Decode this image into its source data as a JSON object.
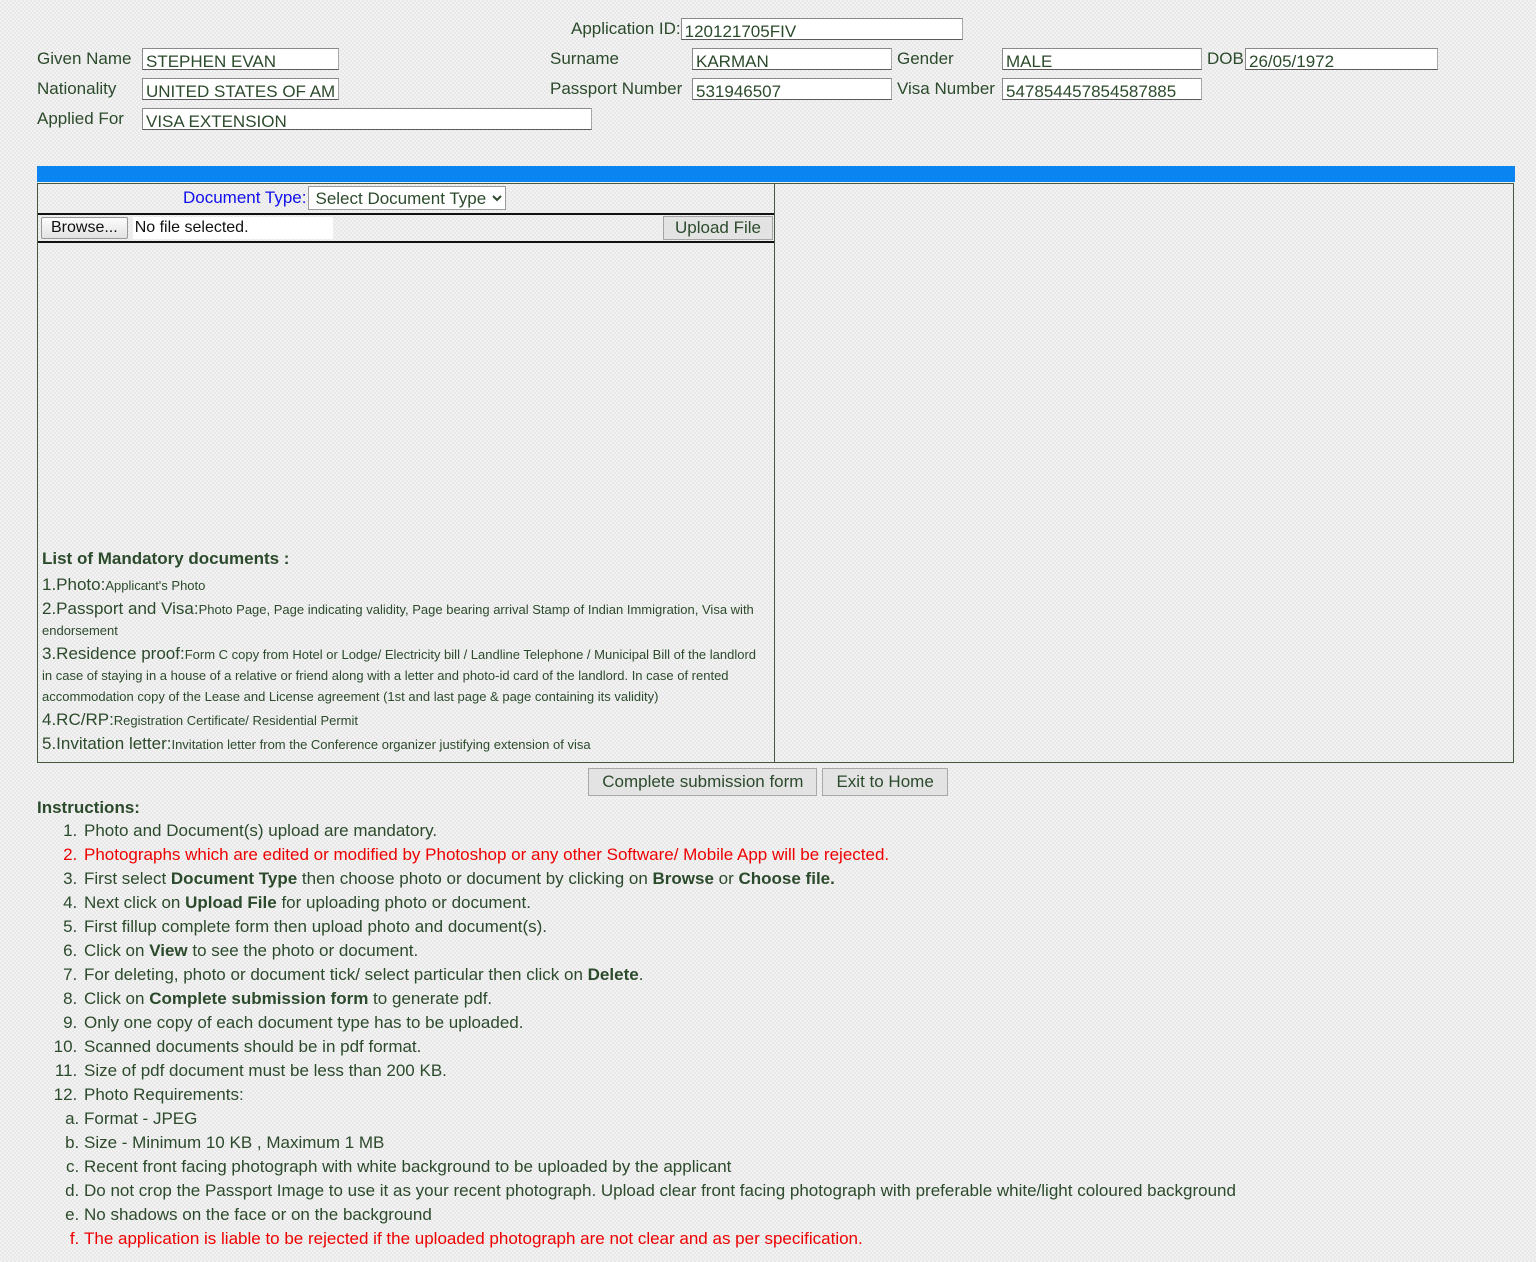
{
  "header": {
    "application_id_label": "Application ID:",
    "application_id_value": "120121705FIV",
    "given_name_label": "Given Name",
    "given_name_value": "STEPHEN EVAN",
    "surname_label": "Surname",
    "surname_value": "KARMAN",
    "gender_label": "Gender",
    "gender_value": "MALE",
    "dob_label": "DOB",
    "dob_value": "26/05/1972",
    "nationality_label": "Nationality",
    "nationality_value": "UNITED STATES OF AM",
    "passport_number_label": "Passport Number",
    "passport_number_value": "531946507",
    "visa_number_label": "Visa Number",
    "visa_number_value": "547854457854587885",
    "applied_for_label": "Applied For",
    "applied_for_value": "VISA EXTENSION"
  },
  "upload": {
    "document_type_label": "Document Type:",
    "document_type_selected": "Select Document Type",
    "document_type_options": [
      "Select Document Type"
    ],
    "browse_button_label": "Browse...",
    "file_status_text": "No file selected.",
    "upload_file_button_label": "Upload File"
  },
  "mandatory": {
    "title": "List of Mandatory documents :",
    "items": [
      {
        "heading": "1.Photo:",
        "desc": "Applicant's Photo"
      },
      {
        "heading": "2.Passport and Visa:",
        "desc": "Photo Page, Page indicating validity, Page bearing arrival Stamp of Indian Immigration, Visa with endorsement"
      },
      {
        "heading": "3.Residence proof:",
        "desc": "Form C copy from Hotel or Lodge/ Electricity bill / Landline Telephone / Municipal Bill of the landlord in case of staying in a house of a relative or friend along with a letter and photo-id card of the landlord. In case of rented accommodation copy of the Lease and License agreement (1st and last page & page containing its validity)"
      },
      {
        "heading": "4.RC/RP:",
        "desc": "Registration Certificate/ Residential Permit"
      },
      {
        "heading": "5.Invitation letter:",
        "desc": "Invitation letter from the Conference organizer justifying extension of visa"
      }
    ]
  },
  "actions": {
    "complete_submission_label": "Complete submission form",
    "exit_to_home_label": "Exit to Home"
  },
  "instructions": {
    "title": "Instructions:",
    "items": [
      "Photo and Document(s) upload are mandatory.",
      "Photographs which are edited or modified by Photoshop or any other Software/ Mobile App will be rejected.",
      "First select Document Type then choose photo or document by clicking on Browse or Choose file.",
      "Next click on Upload File for uploading photo or document.",
      "First fillup complete form then upload photo and document(s).",
      "Click on View to see the photo or document.",
      "For deleting, photo or document tick/ select particular then click on Delete.",
      "Click on Complete submission form to generate pdf.",
      "Only one copy of each document type has to be uploaded.",
      "Scanned documents should be in pdf format.",
      "Size of pdf document must be less than 200 KB.",
      "Photo Requirements:"
    ],
    "photo_requirements": [
      "Format - JPEG",
      "Size - Minimum 10 KB , Maximum 1 MB",
      "Recent front facing photograph with white background to be uploaded by the applicant",
      "Do not crop the Passport Image to use it as your recent photograph. Upload clear front facing photograph with preferable white/light coloured background",
      "No shadows on the face or on the background",
      "The application is liable to be rejected if the uploaded photograph are not clear and as per specification."
    ]
  },
  "colors": {
    "text": "#2c4a2c",
    "accent_blue": "#0a84f0",
    "link_blue": "#1010ee",
    "warning_red": "#ee0000",
    "page_bg": "#f2f2f2"
  }
}
